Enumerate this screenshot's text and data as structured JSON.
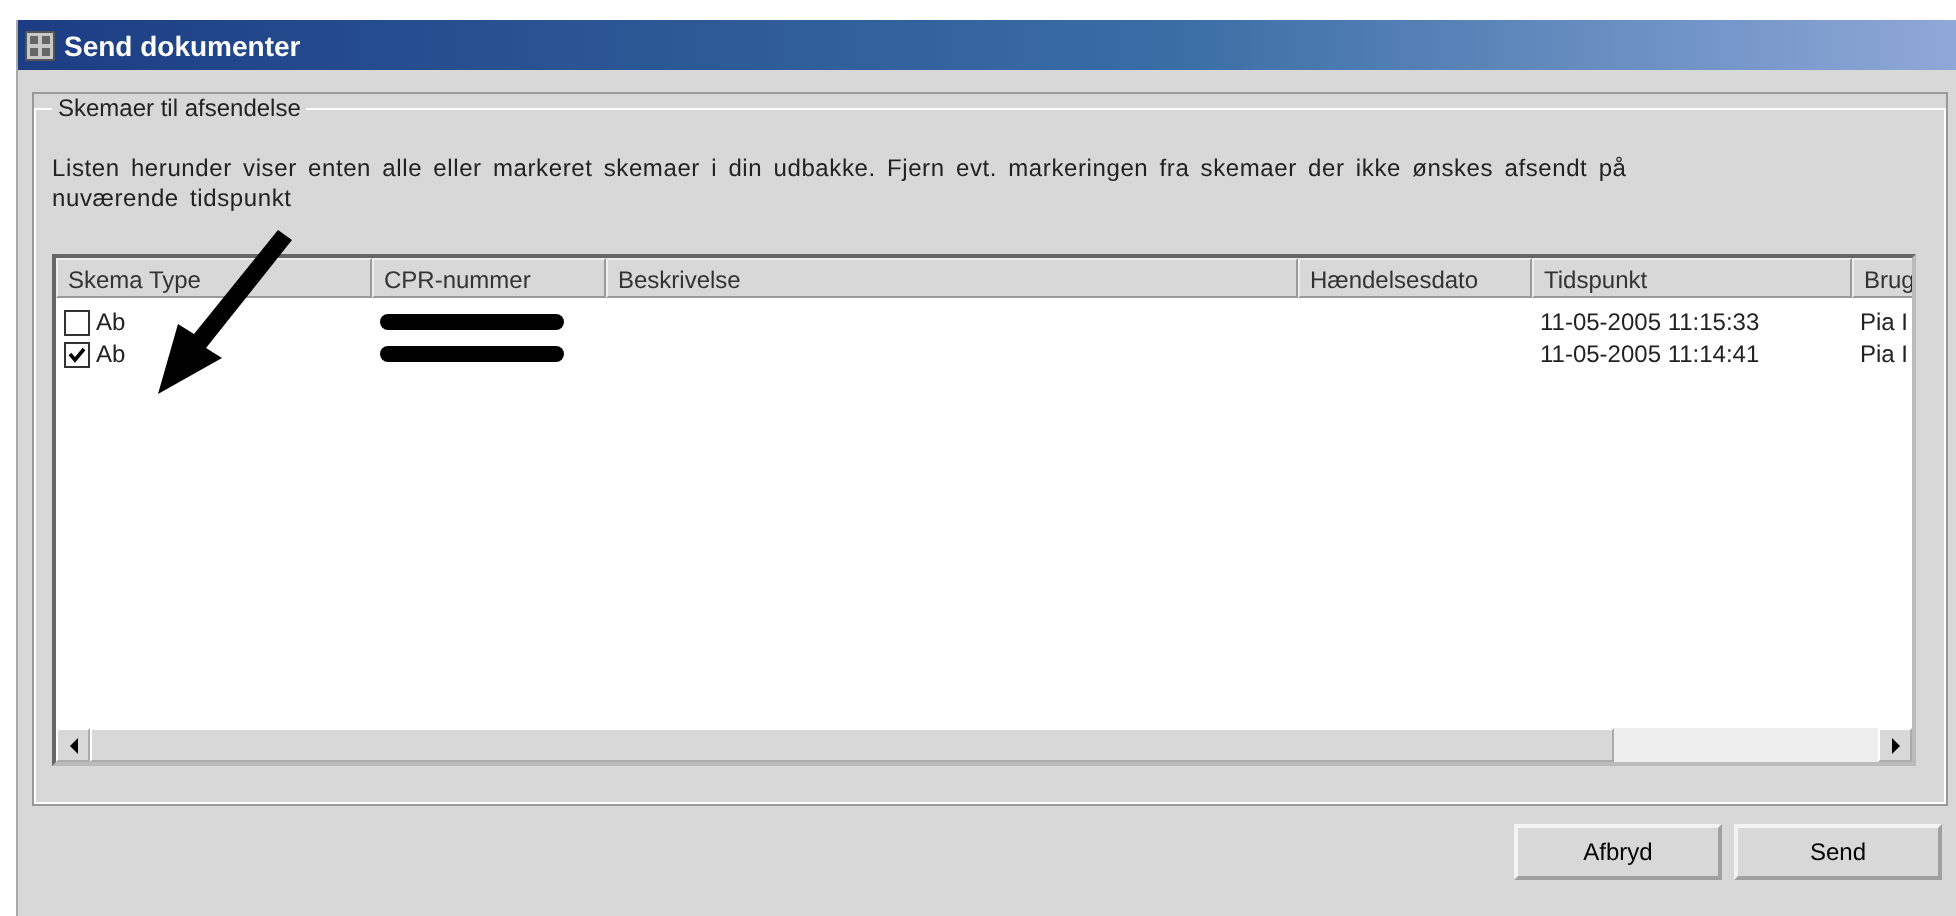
{
  "window": {
    "title": "Send dokumenter"
  },
  "group": {
    "title": "Skemaer til afsendelse",
    "description": "Listen herunder viser enten alle eller markeret skemaer i din udbakke. Fjern evt. markeringen fra skemaer der ikke ønskes afsendt på nuværende tidspunkt"
  },
  "table": {
    "columns": [
      "Skema Type",
      "CPR-nummer",
      "Beskrivelse",
      "Hændelsesdato",
      "Tidspunkt",
      "Brug"
    ],
    "rows": [
      {
        "checked": false,
        "type": "Ab",
        "redacted": true,
        "time": "11-05-2005 11:15:33",
        "user": "Pia I"
      },
      {
        "checked": true,
        "type": "Ab",
        "redacted": true,
        "time": "11-05-2005 11:14:41",
        "user": "Pia I"
      }
    ]
  },
  "buttons": [
    "Afbryd",
    "Send"
  ]
}
